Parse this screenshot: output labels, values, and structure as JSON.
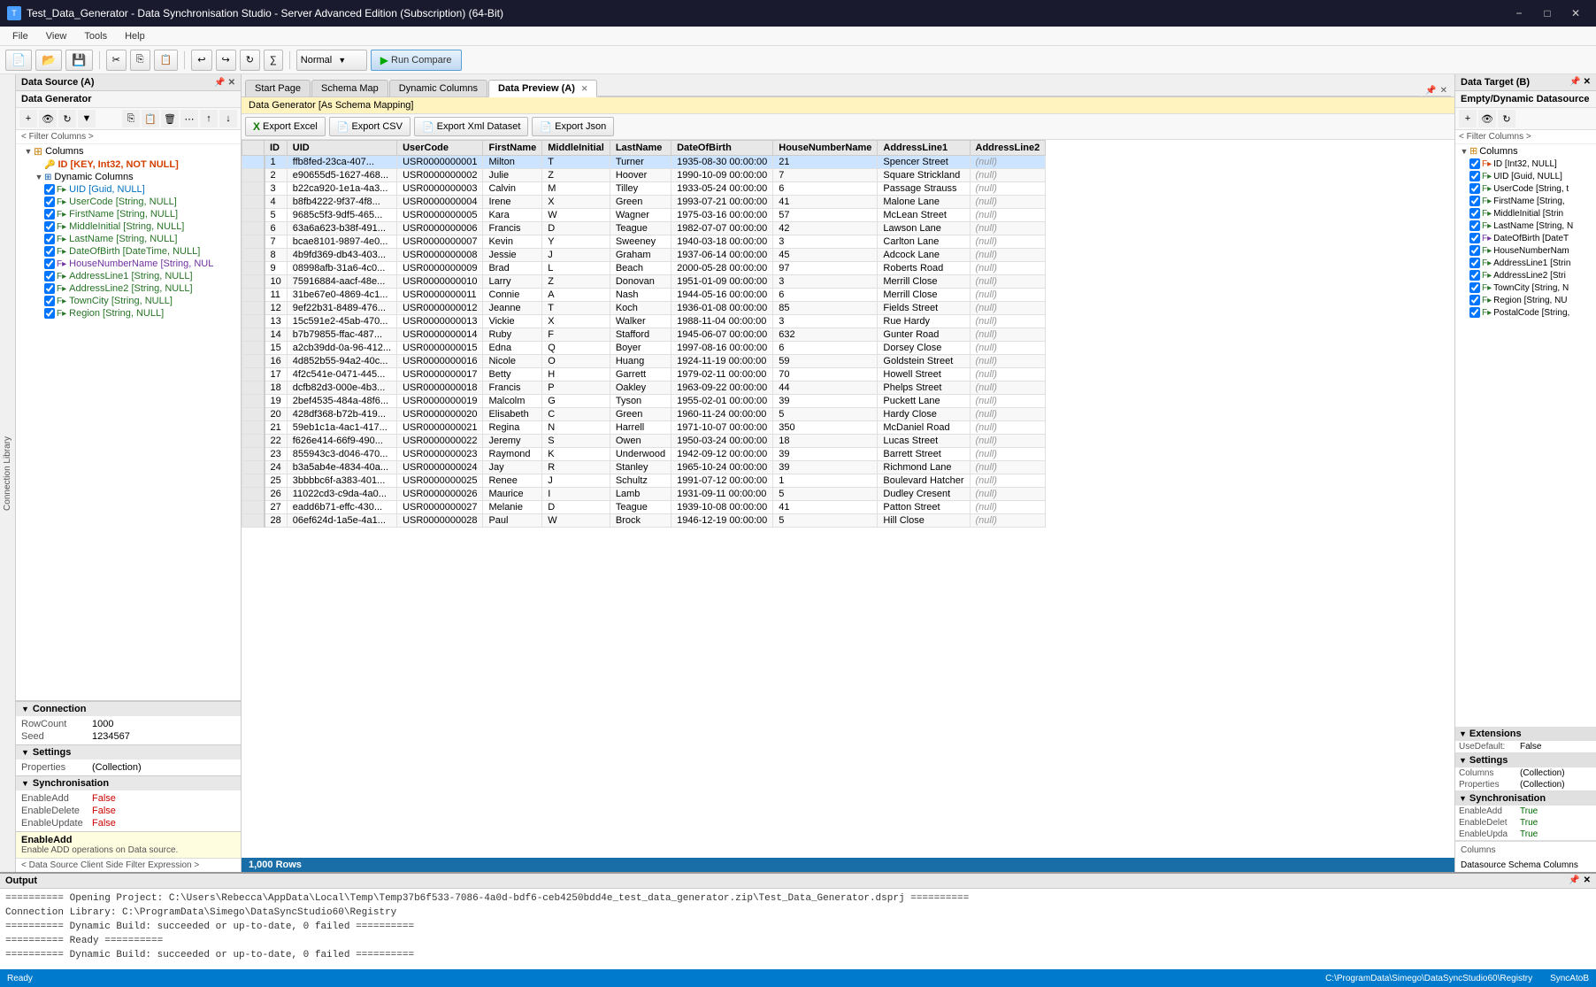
{
  "titleBar": {
    "title": "Test_Data_Generator - Data Synchronisation Studio - Server Advanced Edition (Subscription) (64-Bit)",
    "iconText": "T"
  },
  "menuBar": {
    "items": [
      "File",
      "View",
      "Tools",
      "Help"
    ]
  },
  "toolbar": {
    "normalLabel": "Normal",
    "runCompareLabel": "▶ Run Compare"
  },
  "leftPanel": {
    "header": "Data Source (A)",
    "subHeader": "Data Generator",
    "filterLabel": "< Filter Columns >",
    "tree": {
      "columns": "Columns",
      "idNode": "ID [KEY, Int32, NOT NULL]",
      "dynamicColumns": "Dynamic Columns",
      "fields": [
        "UID [Guid, NULL]",
        "UserCode [String, NULL]",
        "FirstName [String, NULL]",
        "MiddleInitial [String, NULL]",
        "LastName [String, NULL]",
        "DateOfBirth [DateTime, NULL]",
        "HouseNumberName [String, NUL",
        "AddressLine1 [String, NULL]",
        "AddressLine2 [String, NULL]",
        "TownCity [String, NULL]",
        "Region [String, NULL]"
      ]
    },
    "properties": {
      "connection": {
        "header": "Connection",
        "rows": [
          {
            "key": "RowCount",
            "value": "1000"
          },
          {
            "key": "Seed",
            "value": "1234567"
          }
        ]
      },
      "settings": {
        "header": "Settings",
        "rows": [
          {
            "key": "Properties",
            "value": "(Collection)"
          }
        ]
      },
      "synchronisation": {
        "header": "Synchronisation",
        "rows": [
          {
            "key": "EnableAdd",
            "value": "False"
          },
          {
            "key": "EnableDelete",
            "value": "False"
          },
          {
            "key": "EnableUpdate",
            "value": "False"
          }
        ]
      }
    },
    "helpText": "EnableAdd",
    "helpDesc": "Enable ADD operations on Data source."
  },
  "tabs": {
    "items": [
      {
        "id": "start",
        "label": "Start Page",
        "active": false
      },
      {
        "id": "schema",
        "label": "Schema Map",
        "active": false
      },
      {
        "id": "dynamic",
        "label": "Dynamic Columns",
        "active": false
      },
      {
        "id": "preview",
        "label": "Data Preview (A)",
        "active": true
      }
    ]
  },
  "dataPreview": {
    "schemaLabel": "Data Generator [As Schema Mapping]",
    "exportButtons": [
      {
        "id": "excel",
        "label": "Export Excel",
        "icon": "X"
      },
      {
        "id": "csv",
        "label": "Export CSV",
        "icon": "📄"
      },
      {
        "id": "xml",
        "label": "Export Xml Dataset",
        "icon": "📄"
      },
      {
        "id": "json",
        "label": "Export Json",
        "icon": "📄"
      }
    ],
    "columns": [
      "ID",
      "UID",
      "UserCode",
      "FirstName",
      "MiddleInitial",
      "LastName",
      "DateOfBirth",
      "HouseNumberName",
      "AddressLine1",
      "AddressLine2"
    ],
    "rows": [
      [
        1,
        "ffb8fed-23ca-407...",
        "USR0000000001",
        "Milton",
        "T",
        "Turner",
        "1935-08-30 00:00:00",
        "21",
        "Spencer Street",
        "(null)"
      ],
      [
        2,
        "e90655d5-1627-468...",
        "USR0000000002",
        "Julie",
        "Z",
        "Hoover",
        "1990-10-09 00:00:00",
        "7",
        "Square Strickland",
        "(null)"
      ],
      [
        3,
        "b22ca920-1e1a-4a3...",
        "USR0000000003",
        "Calvin",
        "M",
        "Tilley",
        "1933-05-24 00:00:00",
        "6",
        "Passage Strauss",
        "(null)"
      ],
      [
        4,
        "b8fb4222-9f37-4f8...",
        "USR0000000004",
        "Irene",
        "X",
        "Green",
        "1993-07-21 00:00:00",
        "41",
        "Malone Lane",
        "(null)"
      ],
      [
        5,
        "9685c5f3-9df5-465...",
        "USR0000000005",
        "Kara",
        "W",
        "Wagner",
        "1975-03-16 00:00:00",
        "57",
        "McLean Street",
        "(null)"
      ],
      [
        6,
        "63a6a623-b38f-491...",
        "USR0000000006",
        "Francis",
        "D",
        "Teague",
        "1982-07-07 00:00:00",
        "42",
        "Lawson Lane",
        "(null)"
      ],
      [
        7,
        "bcae8101-9897-4e0...",
        "USR0000000007",
        "Kevin",
        "Y",
        "Sweeney",
        "1940-03-18 00:00:00",
        "3",
        "Carlton Lane",
        "(null)"
      ],
      [
        8,
        "4b9fd369-db43-403...",
        "USR0000000008",
        "Jessie",
        "J",
        "Graham",
        "1937-06-14 00:00:00",
        "45",
        "Adcock Lane",
        "(null)"
      ],
      [
        9,
        "08998afb-31a6-4c0...",
        "USR0000000009",
        "Brad",
        "L",
        "Beach",
        "2000-05-28 00:00:00",
        "97",
        "Roberts Road",
        "(null)"
      ],
      [
        10,
        "75916884-aacf-48e...",
        "USR0000000010",
        "Larry",
        "Z",
        "Donovan",
        "1951-01-09 00:00:00",
        "3",
        "Merrill Close",
        "(null)"
      ],
      [
        11,
        "31be67e0-4869-4c1...",
        "USR0000000011",
        "Connie",
        "A",
        "Nash",
        "1944-05-16 00:00:00",
        "6",
        "Merrill Close",
        "(null)"
      ],
      [
        12,
        "9ef22b31-8489-476...",
        "USR0000000012",
        "Jeanne",
        "T",
        "Koch",
        "1936-01-08 00:00:00",
        "85",
        "Fields Street",
        "(null)"
      ],
      [
        13,
        "15c591e2-45ab-470...",
        "USR0000000013",
        "Vickie",
        "X",
        "Walker",
        "1988-11-04 00:00:00",
        "3",
        "Rue Hardy",
        "(null)"
      ],
      [
        14,
        "b7b79855-ffac-487...",
        "USR0000000014",
        "Ruby",
        "F",
        "Stafford",
        "1945-06-07 00:00:00",
        "632",
        "Gunter Road",
        "(null)"
      ],
      [
        15,
        "a2cb39dd-0a-96-412...",
        "USR0000000015",
        "Edna",
        "Q",
        "Boyer",
        "1997-08-16 00:00:00",
        "6",
        "Dorsey Close",
        "(null)"
      ],
      [
        16,
        "4d852b55-94a2-40c...",
        "USR0000000016",
        "Nicole",
        "O",
        "Huang",
        "1924-11-19 00:00:00",
        "59",
        "Goldstein Street",
        "(null)"
      ],
      [
        17,
        "4f2c541e-0471-445...",
        "USR0000000017",
        "Betty",
        "H",
        "Garrett",
        "1979-02-11 00:00:00",
        "70",
        "Howell Street",
        "(null)"
      ],
      [
        18,
        "dcfb82d3-000e-4b3...",
        "USR0000000018",
        "Francis",
        "P",
        "Oakley",
        "1963-09-22 00:00:00",
        "44",
        "Phelps Street",
        "(null)"
      ],
      [
        19,
        "2bef4535-484a-48f6...",
        "USR0000000019",
        "Malcolm",
        "G",
        "Tyson",
        "1955-02-01 00:00:00",
        "39",
        "Puckett Lane",
        "(null)"
      ],
      [
        20,
        "428df368-b72b-419...",
        "USR0000000020",
        "Elisabeth",
        "C",
        "Green",
        "1960-11-24 00:00:00",
        "5",
        "Hardy Close",
        "(null)"
      ],
      [
        21,
        "59eb1c1a-4ac1-417...",
        "USR0000000021",
        "Regina",
        "N",
        "Harrell",
        "1971-10-07 00:00:00",
        "350",
        "McDaniel Road",
        "(null)"
      ],
      [
        22,
        "f626e414-66f9-490...",
        "USR0000000022",
        "Jeremy",
        "S",
        "Owen",
        "1950-03-24 00:00:00",
        "18",
        "Lucas Street",
        "(null)"
      ],
      [
        23,
        "855943c3-d046-470...",
        "USR0000000023",
        "Raymond",
        "K",
        "Underwood",
        "1942-09-12 00:00:00",
        "39",
        "Barrett Street",
        "(null)"
      ],
      [
        24,
        "b3a5ab4e-4834-40a...",
        "USR0000000024",
        "Jay",
        "R",
        "Stanley",
        "1965-10-24 00:00:00",
        "39",
        "Richmond Lane",
        "(null)"
      ],
      [
        25,
        "3bbbbc6f-a383-401...",
        "USR0000000025",
        "Renee",
        "J",
        "Schultz",
        "1991-07-12 00:00:00",
        "1",
        "Boulevard Hatcher",
        "(null)"
      ],
      [
        26,
        "11022cd3-c9da-4a0...",
        "USR0000000026",
        "Maurice",
        "I",
        "Lamb",
        "1931-09-11 00:00:00",
        "5",
        "Dudley Cresent",
        "(null)"
      ],
      [
        27,
        "eadd6b71-effc-430...",
        "USR0000000027",
        "Melanie",
        "D",
        "Teague",
        "1939-10-08 00:00:00",
        "41",
        "Patton Street",
        "(null)"
      ],
      [
        28,
        "06ef624d-1a5e-4a1...",
        "USR0000000028",
        "Paul",
        "W",
        "Brock",
        "1946-12-19 00:00:00",
        "5",
        "Hill Close",
        "(null)"
      ]
    ],
    "rowCount": "1,000 Rows"
  },
  "rightPanel": {
    "header": "Data Target (B)",
    "subHeader": "Empty/Dynamic Datasource",
    "filterLabel": "< Filter Columns >",
    "tree": {
      "columns": "Columns",
      "fields": [
        "ID [Int32, NULL]",
        "UID [Guid, NULL]",
        "UserCode [String, t",
        "FirstName [String,",
        "MiddleInitial [Strin",
        "LastName [String, N",
        "DateOfBirth [DateT",
        "HouseNumberNam",
        "AddressLine1 [Strin",
        "AddressLine2 [Stri",
        "TownCity [String, N",
        "Region [String, NU",
        "PostalCode [String,"
      ]
    },
    "extensions": {
      "header": "Extensions",
      "rows": [
        {
          "key": "UseDefault:",
          "value": "False"
        }
      ]
    },
    "settings": {
      "header": "Settings",
      "rows": [
        {
          "key": "Columns",
          "value": "(Collection)"
        },
        {
          "key": "Properties",
          "value": "(Collection)"
        }
      ]
    },
    "synchronisation": {
      "header": "Synchronisation",
      "rows": [
        {
          "key": "EnableAdd",
          "value": "True"
        },
        {
          "key": "EnableDelet",
          "value": "True"
        },
        {
          "key": "EnableUpda",
          "value": "True"
        }
      ]
    },
    "bottomLabel": "Columns",
    "bottomDesc": "Datasource Schema Columns"
  },
  "outputPanel": {
    "header": "Output",
    "lines": [
      "========== Opening Project: C:\\Users\\Rebecca\\AppData\\Local\\Temp\\Temp37b6f533-7086-4a0d-bdf6-ceb4250bdd4e_test_data_generator.zip\\Test_Data_Generator.dsprj ==========",
      "Connection Library: C:\\ProgramData\\Simego\\DataSyncStudio60\\Registry",
      "========== Dynamic Build: succeeded or up-to-date, 0 failed ==========",
      "========== Ready ==========",
      "========== Dynamic Build: succeeded or up-to-date, 0 failed =========="
    ]
  },
  "statusBar": {
    "left": "Ready",
    "right1": "C:\\ProgramData\\Simego\\DataSyncStudio60\\Registry",
    "right2": "SyncAtoB"
  }
}
